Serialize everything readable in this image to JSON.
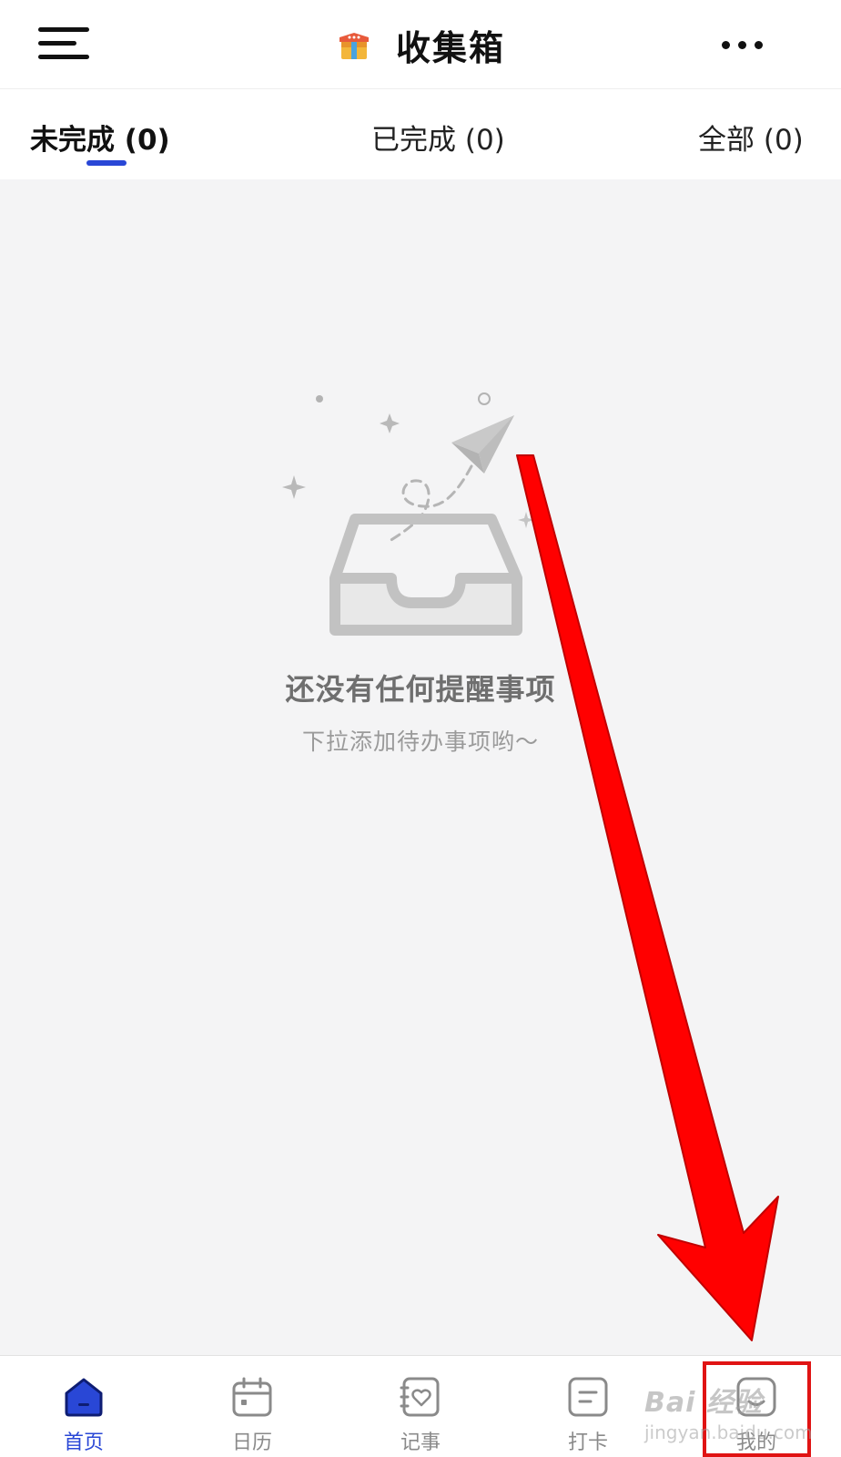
{
  "header": {
    "title": "收集箱",
    "menu_icon": "hamburger-menu-icon",
    "title_icon": "gift-box-icon",
    "more_icon": "more-dots-icon"
  },
  "tabs": [
    {
      "label": "未完成 (0)",
      "active": true
    },
    {
      "label": "已完成 (0)",
      "active": false
    },
    {
      "label": "全部 (0)",
      "active": false
    }
  ],
  "empty_state": {
    "title": "还没有任何提醒事项",
    "subtitle": "下拉添加待办事项哟～",
    "icon": "inbox-paper-plane-illustration"
  },
  "bottom_nav": {
    "items": [
      {
        "label": "首页",
        "icon": "home-icon",
        "active": true
      },
      {
        "label": "日历",
        "icon": "calendar-icon",
        "active": false
      },
      {
        "label": "记事",
        "icon": "notebook-heart-icon",
        "active": false
      },
      {
        "label": "打卡",
        "icon": "checkin-note-icon",
        "active": false
      },
      {
        "label": "我的",
        "icon": "profile-icon",
        "active": false
      }
    ]
  },
  "annotation": {
    "arrow_color": "#ff0000",
    "highlight_color": "#e01313",
    "watermark_text": "Bai 经验",
    "watermark_url": "jingyan.baidu.com"
  },
  "colors": {
    "accent": "#2947d6",
    "background": "#f4f4f5",
    "header_bg": "#ffffff"
  }
}
